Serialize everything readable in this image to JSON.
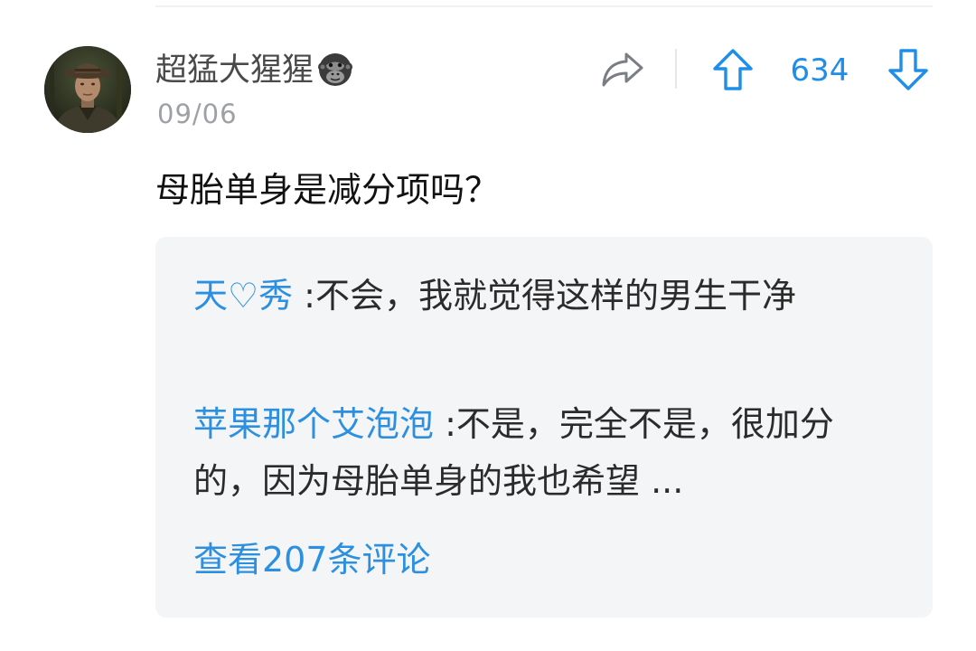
{
  "post": {
    "author": {
      "name": "超猛大猩猩",
      "badge_icon": "gorilla-icon",
      "avatar_icon": "avatar-photo"
    },
    "date": "09/06",
    "text": "母胎单身是减分项吗？",
    "actions": {
      "share_icon": "share-icon",
      "upvote_icon": "arrow-up-icon",
      "downvote_icon": "arrow-down-icon",
      "vote_count": "634",
      "accent_color": "#1e8ee8"
    }
  },
  "comments": {
    "items": [
      {
        "author": "天♡秀",
        "separator": ":",
        "text": "不会，我就觉得这样的男生干净"
      },
      {
        "author": "苹果那个艾泡泡",
        "separator": ":",
        "text": "不是，完全不是，很加分的，因为母胎单身的我也希望 ..."
      }
    ],
    "view_all_label": "查看207条评论"
  }
}
